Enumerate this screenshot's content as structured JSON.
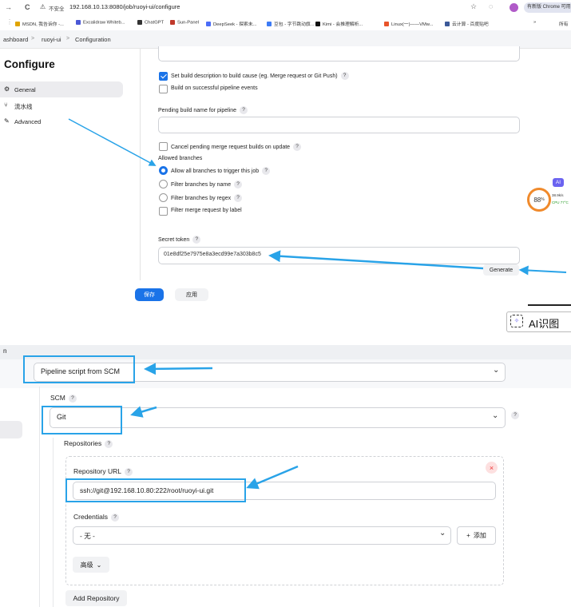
{
  "browser": {
    "nav_back": "→",
    "reload": "C",
    "security_label": "不安全",
    "url": "192.168.10.13:8080/job/ruoyi-ui/configure",
    "profile_notice": "有新版 Chrome 可用"
  },
  "bookmarks": [
    {
      "label": "MSDN, 我告诉你 -...",
      "color": "#e0a400"
    },
    {
      "label": "Excalidraw Whiteb...",
      "color": "#4a58d6"
    },
    {
      "label": "ChatGPT",
      "color": "#333333"
    },
    {
      "label": "Sun-Panel",
      "color": "#c0392b"
    },
    {
      "label": "DeepSeek - 探索未...",
      "color": "#4b6cf7"
    },
    {
      "label": "豆包 - 字节跳动旗...",
      "color": "#3d7bf5"
    },
    {
      "label": "Kimi - 会推理解析...",
      "color": "#111111"
    },
    {
      "label": "Linux(一)——VMw...",
      "color": "#e8542a"
    },
    {
      "label": "云计算 - 百度贴吧",
      "color": "#3b5998"
    },
    {
      "label": "»",
      "color": ""
    },
    {
      "label": "所有",
      "color": ""
    }
  ],
  "breadcrumb": {
    "items": [
      "ashboard",
      "ruoyi-ui",
      "Configuration"
    ],
    "sep": ">"
  },
  "sidebar": {
    "title": "Configure",
    "items": [
      {
        "label": "General",
        "icon": "gear-icon"
      },
      {
        "label": "流水线",
        "icon": "pipeline-icon"
      },
      {
        "label": "Advanced",
        "icon": "wrench-icon"
      }
    ]
  },
  "form": {
    "set_desc_label": "Set build description to build cause (eg. Merge request or Git Push)",
    "set_desc_checked": true,
    "build_success_label": "Build on successful pipeline events",
    "pending_name_label": "Pending build name for pipeline",
    "pending_name_value": "",
    "cancel_pending_label": "Cancel pending merge request builds on update",
    "allowed_branches_label": "Allowed branches",
    "branch_options": [
      {
        "label": "Allow all branches to trigger this job",
        "selected": true
      },
      {
        "label": "Filter branches by name",
        "selected": false
      },
      {
        "label": "Filter branches by regex",
        "selected": false
      }
    ],
    "filter_mr_label": "Filter merge request by label",
    "secret_token_label": "Secret token",
    "secret_token_value": "01e8df25e7975e8a3ecd99e7a303b8c5",
    "generate_label": "Generate",
    "help_mark": "?"
  },
  "footer": {
    "save_label": "保存",
    "apply_label": "应用"
  },
  "widget": {
    "ai_badge": "AI",
    "cpu_percent": "88",
    "percent_sign": "%",
    "cpu_text": "CPU 77°C",
    "net_text": "38.9k/s"
  },
  "ai_recognize": {
    "label": "AI识图"
  },
  "pipeline": {
    "section_label": "n",
    "definition_value": "Pipeline script from SCM",
    "scm_label": "SCM",
    "scm_value": "Git",
    "repositories_label": "Repositories",
    "repo_url_label": "Repository URL",
    "repo_url_value": "ssh://git@192.168.10.80:222/root/ruoyi-ui.git",
    "credentials_label": "Credentials",
    "credentials_value": "- 无 -",
    "add_label": "添加",
    "add_plus": "+",
    "advanced_label": "高级",
    "add_repo_label": "Add Repository",
    "remove_symbol": "×"
  },
  "colors": {
    "accent": "#1a73e8",
    "arrow": "#29a3e8",
    "save_bg": "#1a73e8",
    "widget_ring": "#f08a2c"
  }
}
